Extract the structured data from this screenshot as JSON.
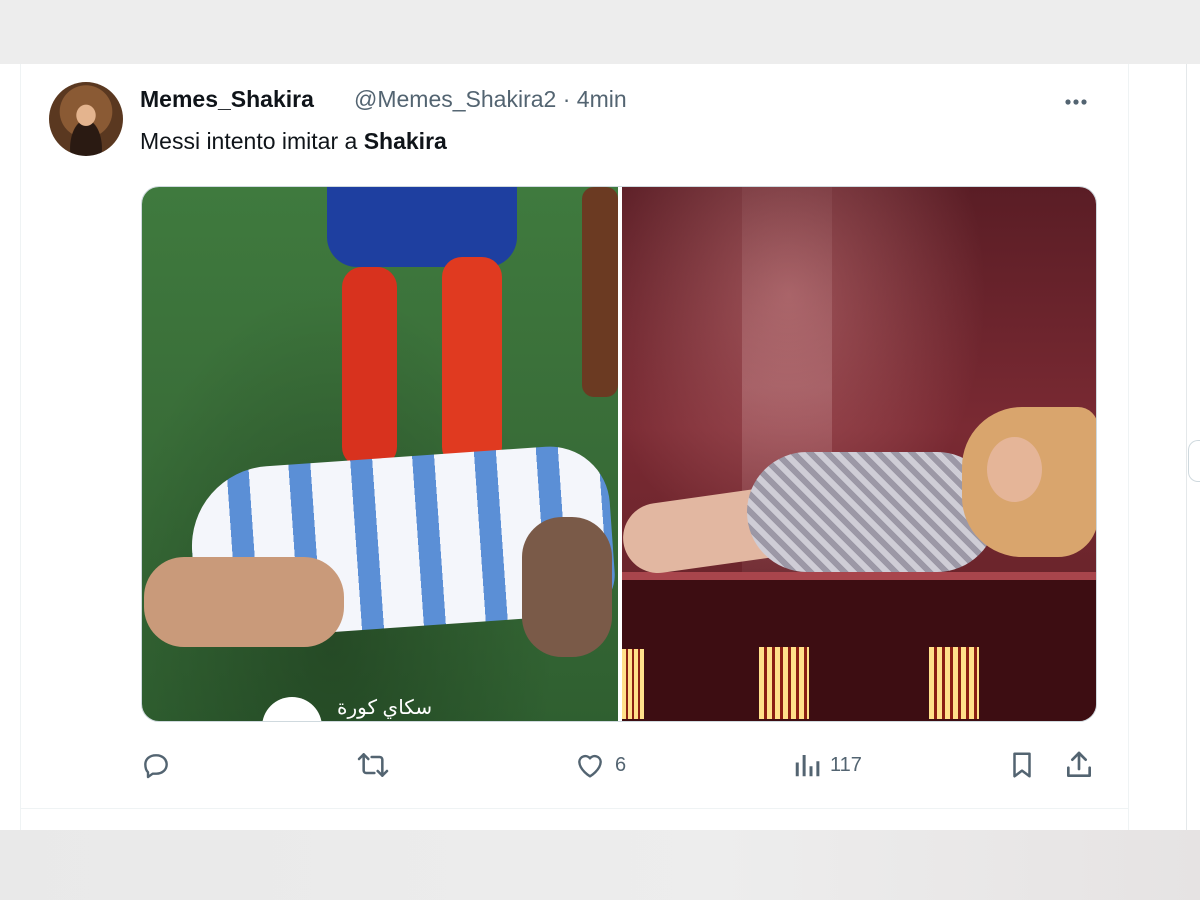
{
  "tweet": {
    "author_name": "Memes_Shakira",
    "handle": "@Memes_Shakira2",
    "separator": "·",
    "time": "4min",
    "text_prefix": "Messi intento imitar a ",
    "text_bold": "Shakira",
    "media_watermark": "سكاي كورة"
  },
  "actions": {
    "reply_count": "",
    "retweet_count": "",
    "like_count": "6",
    "views_count": "117"
  },
  "icons": {
    "more": "more-horizontal-icon",
    "reply": "reply-icon",
    "retweet": "retweet-icon",
    "like": "heart-icon",
    "views": "views-icon",
    "bookmark": "bookmark-icon",
    "share": "share-icon"
  },
  "colors": {
    "text": "#0f1419",
    "secondary": "#536471",
    "border": "#cfd9de"
  }
}
